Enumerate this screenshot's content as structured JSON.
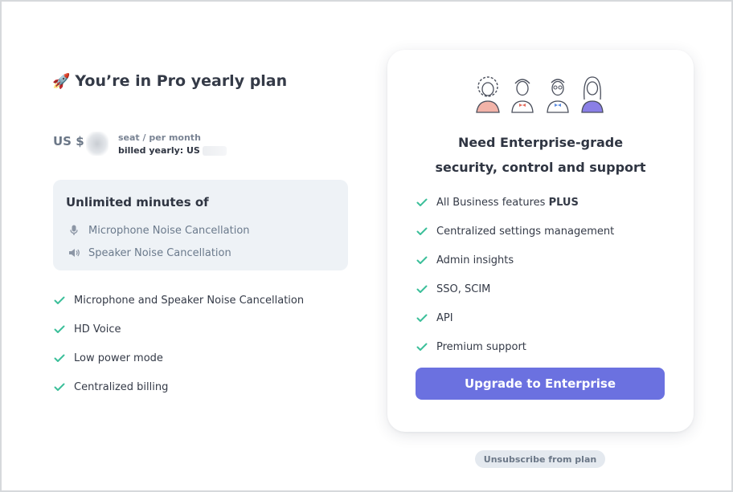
{
  "plan": {
    "title_icon": "rocket-icon",
    "title": "You’re in Pro yearly plan",
    "price_currency": "US $",
    "seat_label": "seat / per month",
    "billed_label": "billed yearly: US"
  },
  "minutes": {
    "title": "Unlimited minutes of",
    "items": [
      {
        "icon": "microphone-icon",
        "label": "Microphone Noise Cancellation"
      },
      {
        "icon": "speaker-icon",
        "label": "Speaker Noise Cancellation"
      }
    ]
  },
  "features": [
    "Microphone and Speaker Noise Cancellation",
    "HD Voice",
    "Low power mode",
    "Centralized billing"
  ],
  "enterprise": {
    "heading_line1": "Need Enterprise-grade",
    "heading_line2": "security, control and support",
    "feature0_prefix": "All Business features",
    "feature0_plus": "PLUS",
    "features": [
      "Centralized settings management",
      "Admin insights",
      "SSO, SCIM",
      "API",
      "Premium support"
    ],
    "upgrade_label": "Upgrade to Enterprise"
  },
  "unsubscribe_label": "Unsubscribe from plan",
  "colors": {
    "accent": "#6b71e0",
    "check": "#3cbf9a",
    "box_bg": "#eef2f6"
  }
}
